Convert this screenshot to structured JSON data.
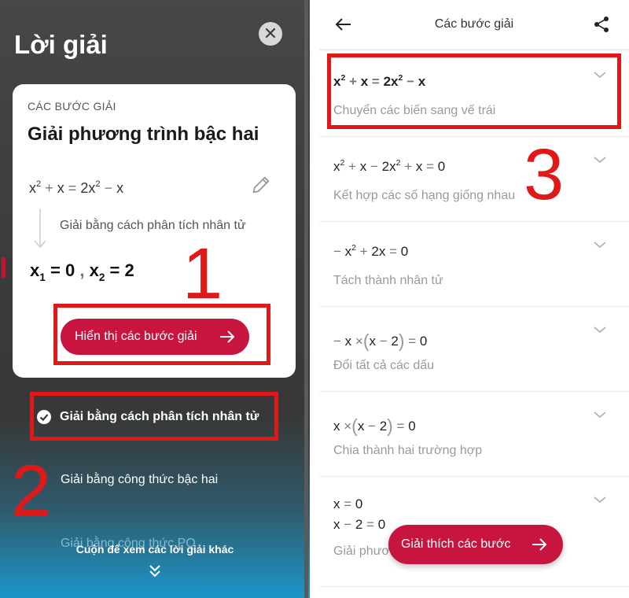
{
  "left": {
    "title": "Lời giải",
    "card": {
      "steps_label": "CÁC BƯỚC GIẢI",
      "method_title": "Giải phương trình bậc hai",
      "equation": {
        "a": "x",
        "exp_a": "2",
        "plus": "+",
        "b": "x",
        "eq": "=",
        "c": "2x",
        "exp_c": "2",
        "minus": "−",
        "d": "x"
      },
      "method_desc": "Giải bằng cách phân tích nhân tử",
      "result": {
        "x1": "x",
        "sub1": "1",
        "eq1": "=",
        "val1": "0",
        "comma": ",",
        "x2": "x",
        "sub2": "2",
        "eq2": "=",
        "val2": "2"
      },
      "show_steps_label": "Hiển thị các bước giải"
    },
    "methods": [
      "Giải bằng cách phân tích nhân tử",
      "Giải bằng công thức bậc hai",
      "Giải bằng công thức PQ"
    ],
    "scroll_hint": "Cuộn để xem các lời giải khác"
  },
  "annotations": {
    "n1": "1",
    "n2": "2",
    "n3": "3"
  },
  "right": {
    "header_title": "Các bước giải",
    "steps": [
      {
        "caption": "Chuyển các biến sang vế trái"
      },
      {
        "caption": "Kết hợp các số hạng giống nhau"
      },
      {
        "caption": "Tách thành nhân tử"
      },
      {
        "caption": "Đổi tất cả các dấu"
      },
      {
        "caption": "Chia thành hai trường hợp"
      },
      {
        "caption": "Giải phương trình"
      }
    ],
    "explain_label": "Giải thích các bước"
  },
  "colors": {
    "accent": "#c8153f",
    "annotation": "#e01818",
    "panel_dark": "#3b3b3b"
  }
}
